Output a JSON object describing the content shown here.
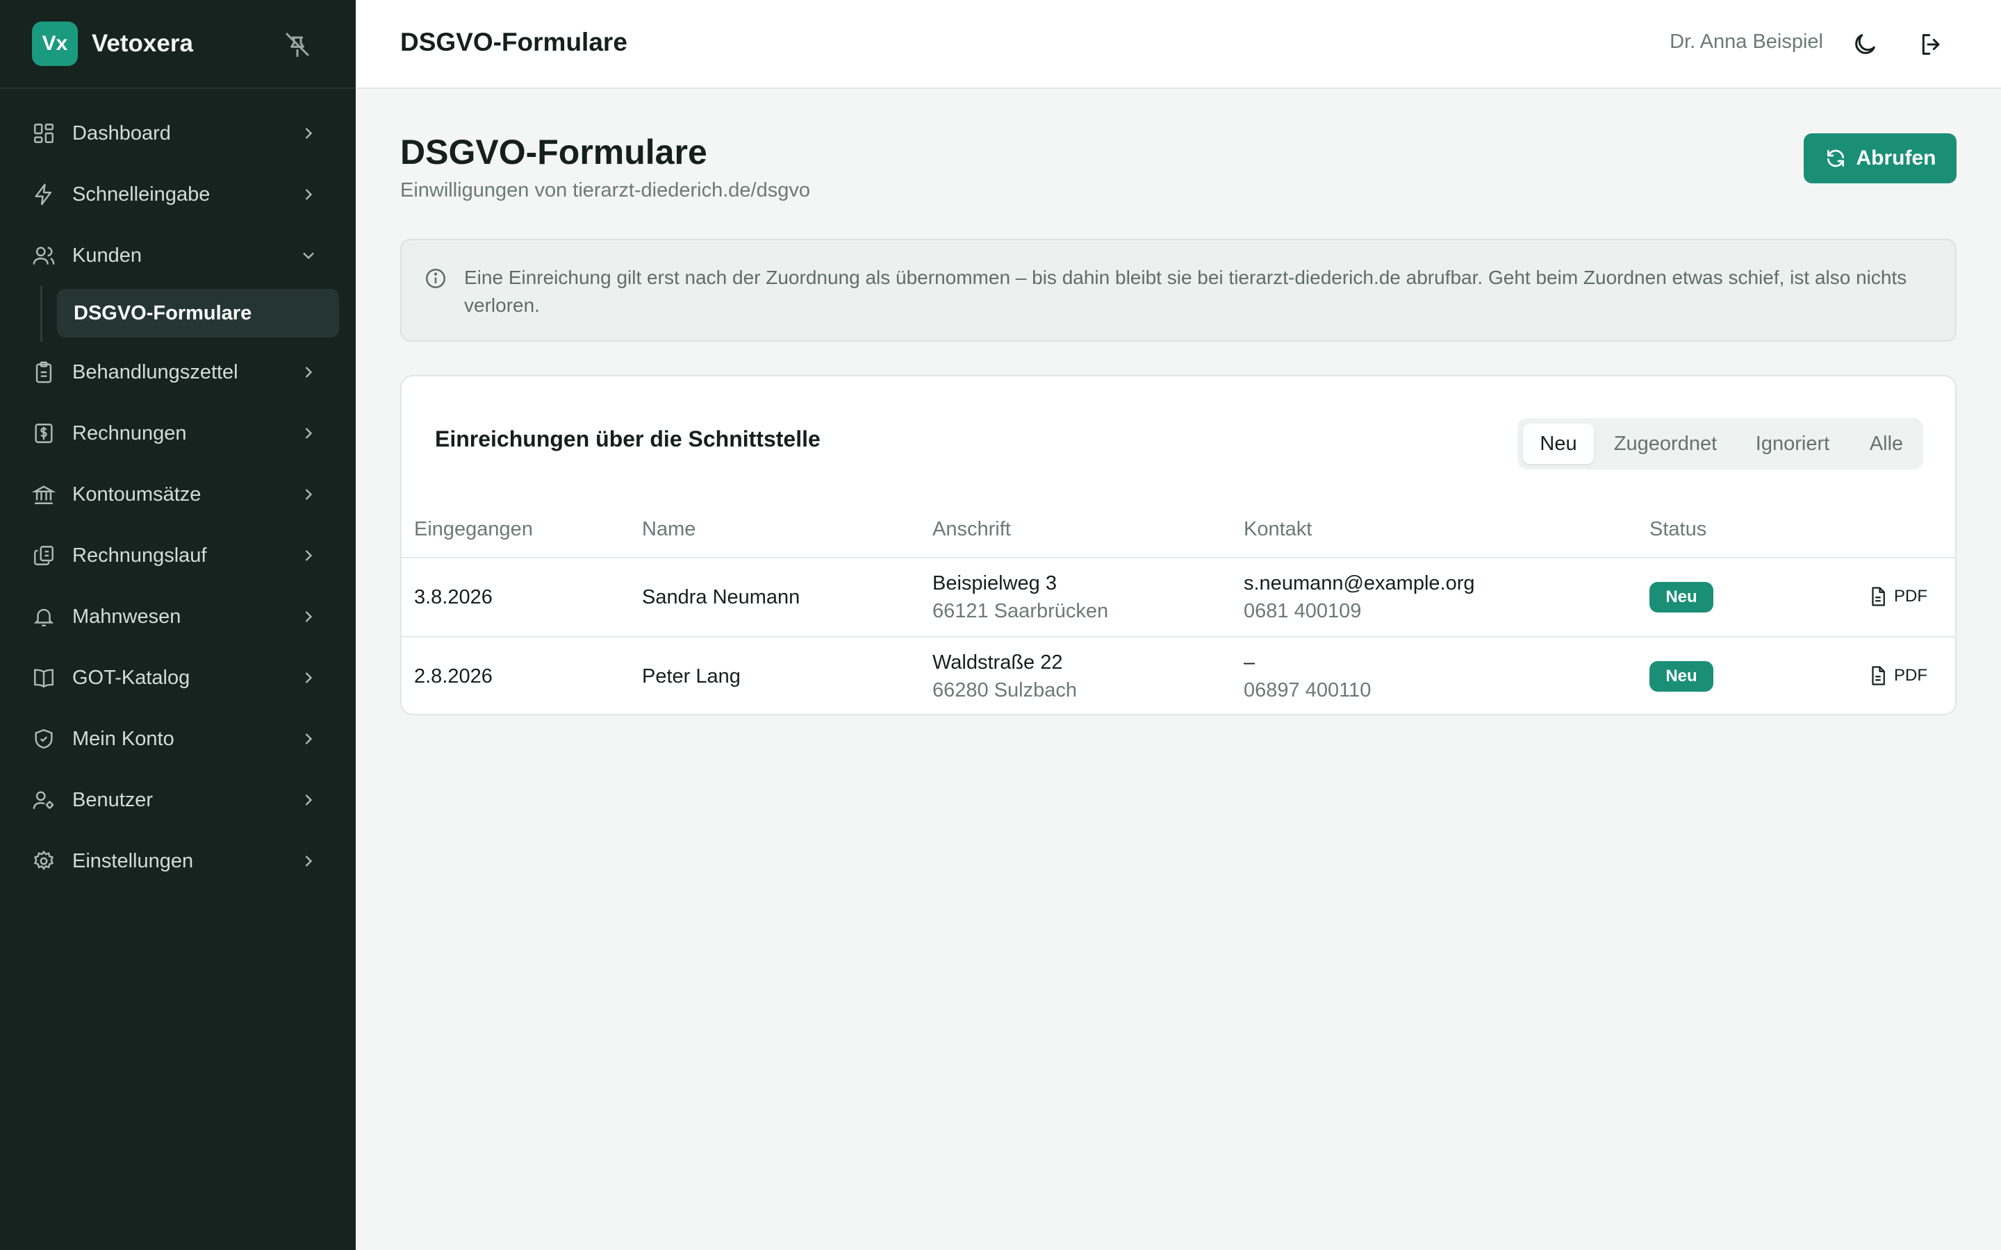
{
  "app": {
    "logo_text": "Vx",
    "name": "Vetoxera"
  },
  "sidebar": {
    "items": [
      {
        "label": "Dashboard",
        "icon": "dashboard-icon"
      },
      {
        "label": "Schnelleingabe",
        "icon": "bolt-icon"
      },
      {
        "label": "Kunden",
        "icon": "users-icon",
        "expanded": true
      },
      {
        "label": "Behandlungszettel",
        "icon": "clipboard-icon"
      },
      {
        "label": "Rechnungen",
        "icon": "invoice-icon"
      },
      {
        "label": "Kontoumsätze",
        "icon": "bank-icon"
      },
      {
        "label": "Rechnungslauf",
        "icon": "copy-icon"
      },
      {
        "label": "Mahnwesen",
        "icon": "bell-icon"
      },
      {
        "label": "GOT-Katalog",
        "icon": "book-icon"
      },
      {
        "label": "Mein Konto",
        "icon": "shield-icon"
      },
      {
        "label": "Benutzer",
        "icon": "user-gear-icon"
      },
      {
        "label": "Einstellungen",
        "icon": "gear-icon"
      }
    ],
    "subitem": "DSGVO-Formulare"
  },
  "header": {
    "title": "DSGVO-Formulare",
    "user": "Dr. Anna Beispiel"
  },
  "page": {
    "title": "DSGVO-Formulare",
    "subtitle": "Einwilligungen von tierarzt-diederich.de/dsgvo",
    "refresh_label": "Abrufen",
    "info": "Eine Einreichung gilt erst nach der Zuordnung als übernommen – bis dahin bleibt sie bei tierarzt-diederich.de abrufbar. Geht beim Zuordnen etwas schief, ist also nichts verloren."
  },
  "card": {
    "title": "Einreichungen über die Schnittstelle",
    "tabs": [
      "Neu",
      "Zugeordnet",
      "Ignoriert",
      "Alle"
    ],
    "active_tab": "Neu",
    "columns": [
      "Eingegangen",
      "Name",
      "Anschrift",
      "Kontakt",
      "Status"
    ],
    "rows": [
      {
        "date": "3.8.2026",
        "name": "Sandra Neumann",
        "street": "Beispielweg 3",
        "city": "66121 Saarbrücken",
        "email": "s.neumann@example.org",
        "phone": "0681 400109",
        "status": "Neu",
        "pdf": "PDF"
      },
      {
        "date": "2.8.2026",
        "name": "Peter Lang",
        "street": "Waldstraße 22",
        "city": "66280 Sulzbach",
        "email": "–",
        "phone": "06897 400110",
        "status": "Neu",
        "pdf": "PDF"
      }
    ]
  },
  "colors": {
    "sidebar_bg": "#16231f",
    "accent": "#1a8f76",
    "page_bg": "#f4f6f5"
  }
}
